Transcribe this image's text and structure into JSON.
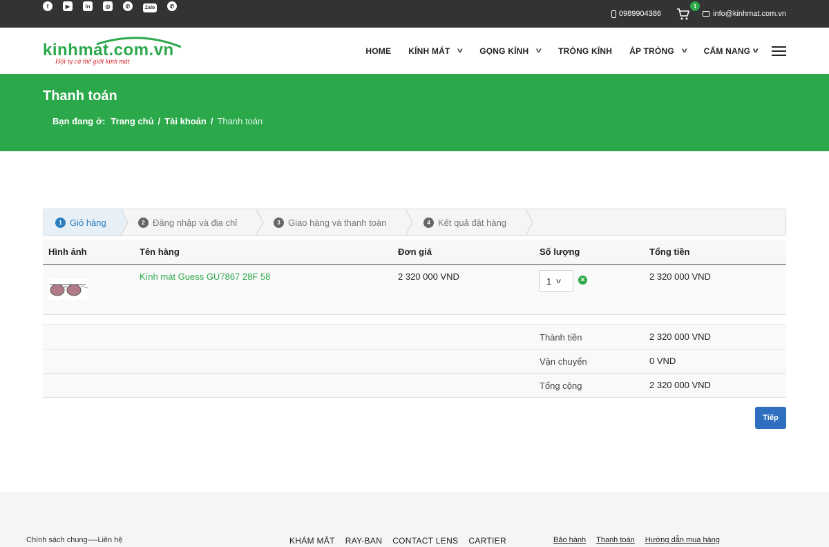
{
  "topbar": {
    "social_icons": [
      "facebook-icon",
      "youtube-icon",
      "linkedin-icon",
      "instagram-icon",
      "whatsapp-icon",
      "zalo-icon",
      "viber-icon"
    ],
    "zalo_label": "Zalo",
    "phone": "0989904386",
    "cart_count": "1",
    "email": "info@kinhmat.com.vn"
  },
  "header": {
    "logo_text": "kinhmat.com.vn",
    "logo_tagline": "Hội tụ cả thế giới kính mát",
    "nav": [
      {
        "label": "HOME"
      },
      {
        "label": "KÍNH MÁT"
      },
      {
        "label": "GỌNG KÍNH"
      },
      {
        "label": "TRÒNG KÍNH"
      },
      {
        "label": "ÁP TRÒNG"
      },
      {
        "label": "CẨM NANG"
      }
    ]
  },
  "banner": {
    "title": "Thanh toán",
    "breadcrumb_label": "Bạn đang ở:",
    "breadcrumb": [
      "Trang chủ",
      "Tài khoản",
      "Thanh toán"
    ]
  },
  "steps": [
    {
      "num": "1",
      "label": "Giỏ hàng"
    },
    {
      "num": "2",
      "label": "Đăng nhập và địa chỉ"
    },
    {
      "num": "3",
      "label": "Giao hàng và thanh toán"
    },
    {
      "num": "4",
      "label": "Kết quả đặt hàng"
    }
  ],
  "table": {
    "headers": [
      "Hình ảnh",
      "Tên hàng",
      "Đơn giá",
      "Số lượng",
      "Tổng tiền"
    ],
    "rows": [
      {
        "name": "Kính mát Guess GU7867 28F 58",
        "price": "2 320 000 VND",
        "qty": "1",
        "total": "2 320 000 VND"
      }
    ]
  },
  "summary": [
    {
      "label": "Thành tiền",
      "value": "2 320 000 VND"
    },
    {
      "label": "Vận chuyển",
      "value": "0 VND"
    },
    {
      "label": "Tổng cộng",
      "value": "2 320 000 VND"
    }
  ],
  "next_label": "Tiếp",
  "footer": {
    "policy": "Chính sách chung----Liên hệ",
    "nav": [
      "KHÁM MẮT",
      "RAY-BAN",
      "CONTACT LENS",
      "CARTIER"
    ],
    "links": [
      "Bảo hành",
      "Thanh toán",
      "Hướng dẫn mua hàng"
    ]
  },
  "colors": {
    "brand_green": "#2aa84a",
    "topbar": "#333333",
    "button_blue": "#2f6fc0",
    "step_active": "#2a7fc1"
  }
}
